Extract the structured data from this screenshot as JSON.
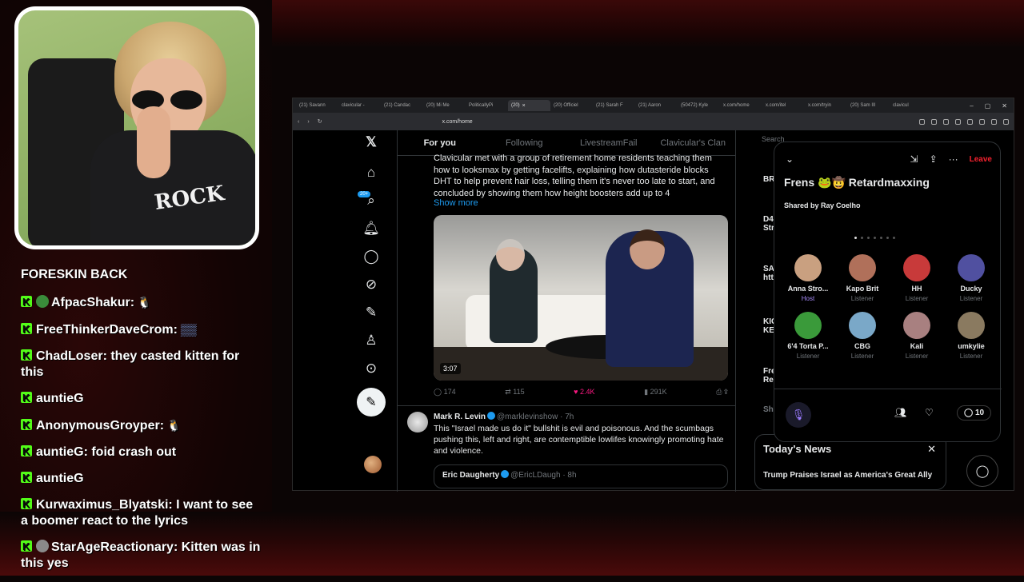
{
  "browser": {
    "tabs": [
      "(21) Savann",
      "clavicular -",
      "(21) Candac",
      "(20) Mi Me",
      "PoliticallyPi",
      "(20)",
      "(20) Officiel",
      "(21) Sarah F",
      "(21) Aaron",
      "(50472) Kyle",
      "x.com/home",
      "x.com/itel",
      "x.com/tryin",
      "(20) Sam III",
      "clavicul"
    ],
    "url": "x.com/home"
  },
  "x": {
    "notif_count": "20+",
    "feed_tabs": [
      "For you",
      "Following",
      "LivestreamFail",
      "Clavicular's Clan"
    ],
    "post1": {
      "text": "Clavicular met with a group of retirement home residents teaching them how to looksmax by getting facelifts, explaining how dutasteride blocks DHT to help prevent hair loss, telling them it's never too late to start, and concluded by showing them how height boosters add up to 4",
      "show_more": "Show more",
      "duration": "3:07",
      "replies": "174",
      "reposts": "115",
      "likes": "2.4K",
      "views": "291K"
    },
    "post2": {
      "name": "Mark R. Levin",
      "handle": "@marklevinshow",
      "time": "· 7h",
      "text": "This \"Israel made us do it\" bullshit is evil and poisonous. And the scumbags pushing this, left and right, are contemptible lowlifes knowingly promoting hate and violence."
    },
    "quote": {
      "name": "Eric Daugherty",
      "handle": "@EricLDaugh",
      "time": "· 8h"
    },
    "search_placeholder": "Search",
    "right_frags": [
      "BR",
      "D4 Str",
      "SA htt",
      "KIC KE",
      "Fre Re",
      "Sh"
    ],
    "news": {
      "title": "Today's News",
      "headline": "Trump Praises Israel as America's Great Ally"
    }
  },
  "space": {
    "leave": "Leave",
    "title": "Frens 🐸🤠 Retardmaxxing",
    "shared_by": "Shared by Ray Coelho",
    "people": [
      {
        "name": "Anna Stro...",
        "role": "Host",
        "color": "#c9a080"
      },
      {
        "name": "Kapo Brit",
        "role": "Listener",
        "color": "#b0705a"
      },
      {
        "name": "HH",
        "role": "Listener",
        "color": "#c83a3a"
      },
      {
        "name": "Ducky",
        "role": "Listener",
        "color": "#5050a0"
      },
      {
        "name": "6'4 Torta P...",
        "role": "Listener",
        "color": "#3a9a3a"
      },
      {
        "name": "CBG",
        "role": "Listener",
        "color": "#7aa8c8"
      },
      {
        "name": "Kali",
        "role": "Listener",
        "color": "#a88080"
      },
      {
        "name": "umkylie",
        "role": "Listener",
        "color": "#8a7a60"
      }
    ],
    "comment_count": "10"
  },
  "chat": {
    "lines": [
      {
        "user": "",
        "text": "FORESKIN BACK",
        "badge": ""
      },
      {
        "user": "AfpacShakur",
        "text": " 🐧",
        "badge": "green"
      },
      {
        "user": "FreeThinkerDaveCrom",
        "text": " ▒▒",
        "badge": ""
      },
      {
        "user": "ChadLoser",
        "text": " they casted kitten for this",
        "badge": ""
      },
      {
        "user": "auntieG",
        "text": "",
        "badge": ""
      },
      {
        "user": "AnonymousGroyper",
        "text": " 🐧",
        "badge": ""
      },
      {
        "user": "auntieG",
        "text": " foid crash out",
        "badge": ""
      },
      {
        "user": "auntieG",
        "text": "",
        "badge": ""
      },
      {
        "user": "Kurwaximus_Blyatski",
        "text": " I want to see a boomer react to the lyrics",
        "badge": ""
      },
      {
        "user": "StarAgeReactionary",
        "text": " Kitten was in this yes",
        "badge": "grey"
      }
    ]
  },
  "webcam": {
    "shirt_text": "ROCK"
  }
}
